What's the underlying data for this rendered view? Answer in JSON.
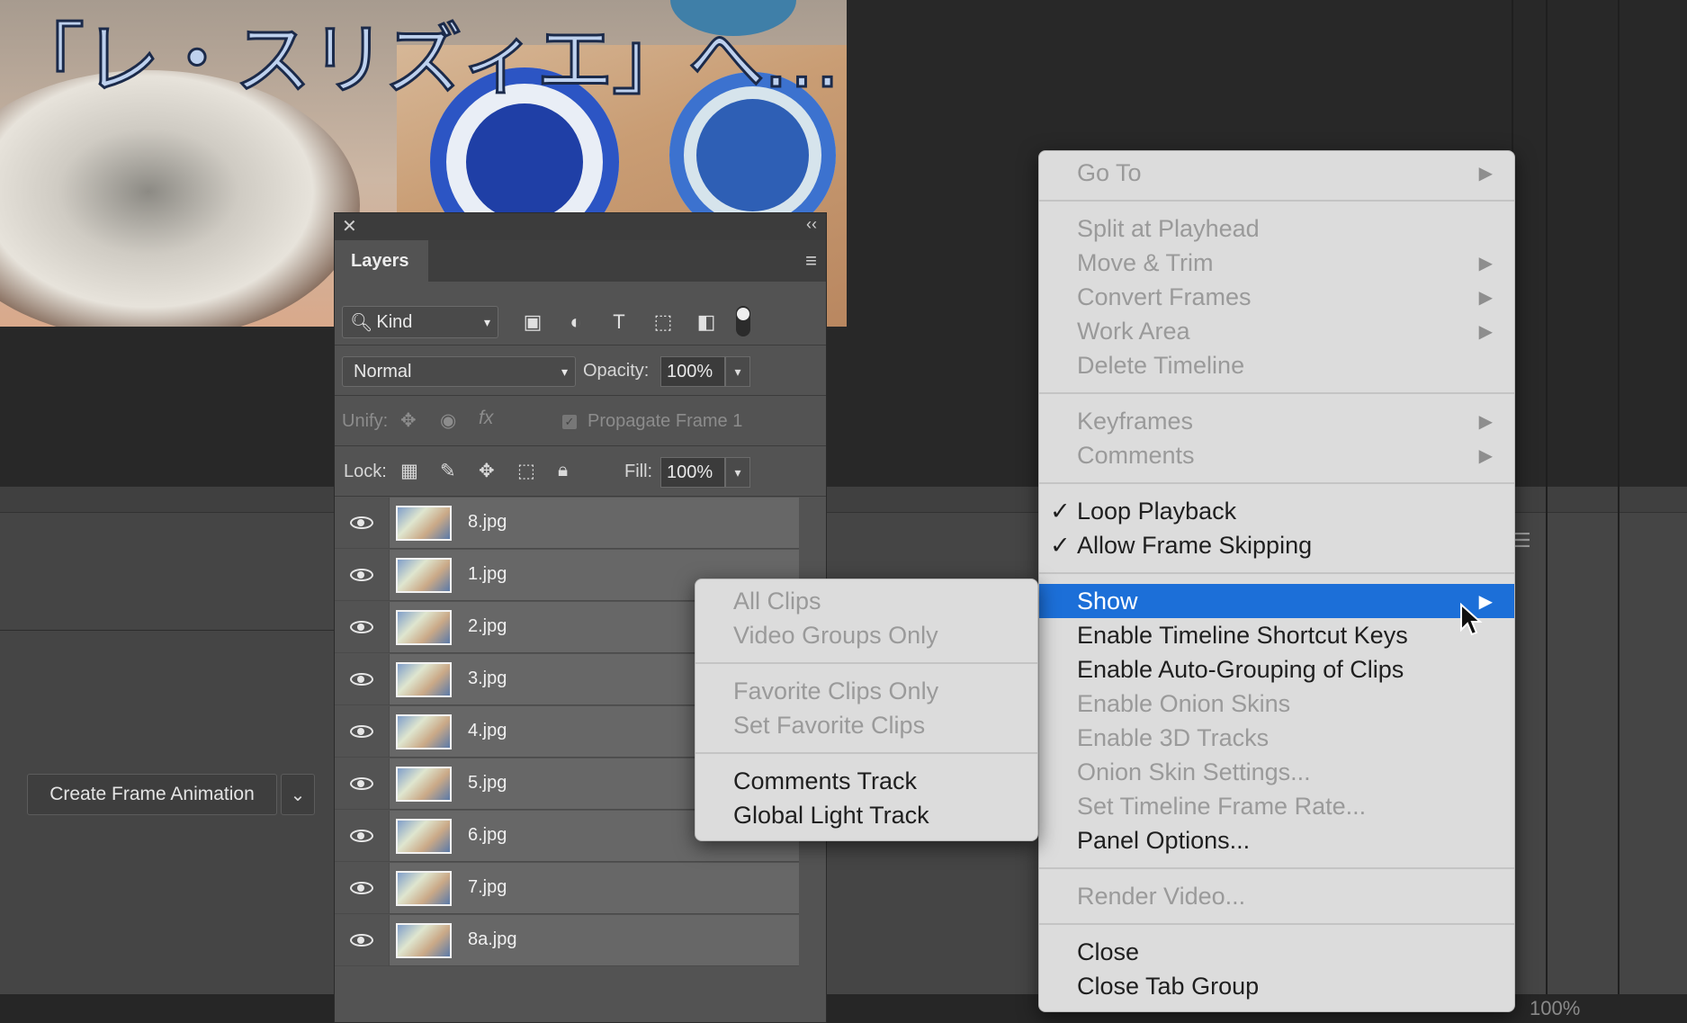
{
  "document": {
    "title_text": "「レ・スリズィエ」へ…"
  },
  "layers_panel": {
    "tab_label": "Layers",
    "kind_label": "Kind",
    "blend_mode": "Normal",
    "opacity_label": "Opacity:",
    "opacity_value": "100%",
    "unify_label": "Unify:",
    "propagate_label": "Propagate Frame 1",
    "lock_label": "Lock:",
    "fill_label": "Fill:",
    "fill_value": "100%",
    "layers": [
      {
        "name": "8.jpg"
      },
      {
        "name": "1.jpg"
      },
      {
        "name": "2.jpg"
      },
      {
        "name": "3.jpg"
      },
      {
        "name": "4.jpg"
      },
      {
        "name": "5.jpg"
      },
      {
        "name": "6.jpg"
      },
      {
        "name": "7.jpg"
      },
      {
        "name": "8a.jpg"
      }
    ]
  },
  "timeline": {
    "create_button_label": "Create Frame Animation",
    "zoom_readout": "100%"
  },
  "context_menu": {
    "items": [
      {
        "label": "Go To",
        "disabled": true,
        "submenu": true
      },
      {
        "label": "Split at Playhead",
        "disabled": true,
        "submenu": false
      },
      {
        "label": "Move & Trim",
        "disabled": true,
        "submenu": true
      },
      {
        "label": "Convert Frames",
        "disabled": true,
        "submenu": true
      },
      {
        "label": "Work Area",
        "disabled": true,
        "submenu": true
      },
      {
        "label": "Delete Timeline",
        "disabled": true,
        "submenu": false
      },
      {
        "label": "Keyframes",
        "disabled": true,
        "submenu": true
      },
      {
        "label": "Comments",
        "disabled": true,
        "submenu": true
      },
      {
        "label": "Loop Playback",
        "disabled": false,
        "checked": true
      },
      {
        "label": "Allow Frame Skipping",
        "disabled": false,
        "checked": true
      },
      {
        "label": "Show",
        "disabled": false,
        "submenu": true,
        "active": true
      },
      {
        "label": "Enable Timeline Shortcut Keys",
        "disabled": false
      },
      {
        "label": "Enable Auto-Grouping of Clips",
        "disabled": false
      },
      {
        "label": "Enable Onion Skins",
        "disabled": true
      },
      {
        "label": "Enable 3D Tracks",
        "disabled": true
      },
      {
        "label": "Onion Skin Settings...",
        "disabled": true
      },
      {
        "label": "Set Timeline Frame Rate...",
        "disabled": true
      },
      {
        "label": "Panel Options...",
        "disabled": false
      },
      {
        "label": "Render Video...",
        "disabled": true
      },
      {
        "label": "Close",
        "disabled": false
      },
      {
        "label": "Close Tab Group",
        "disabled": false
      }
    ],
    "check_glyph": "✓",
    "arrow_glyph": "▶"
  },
  "show_submenu": {
    "items": [
      {
        "label": "All Clips",
        "disabled": true
      },
      {
        "label": "Video Groups Only",
        "disabled": true
      },
      {
        "label": "Favorite Clips Only",
        "disabled": true
      },
      {
        "label": "Set Favorite Clips",
        "disabled": true
      },
      {
        "label": "Comments Track",
        "disabled": false
      },
      {
        "label": "Global Light Track",
        "disabled": false
      }
    ]
  },
  "colors": {
    "menu_highlight": "#1c6fd8",
    "menu_background": "#dcdcdc",
    "panel_background": "#535353"
  }
}
